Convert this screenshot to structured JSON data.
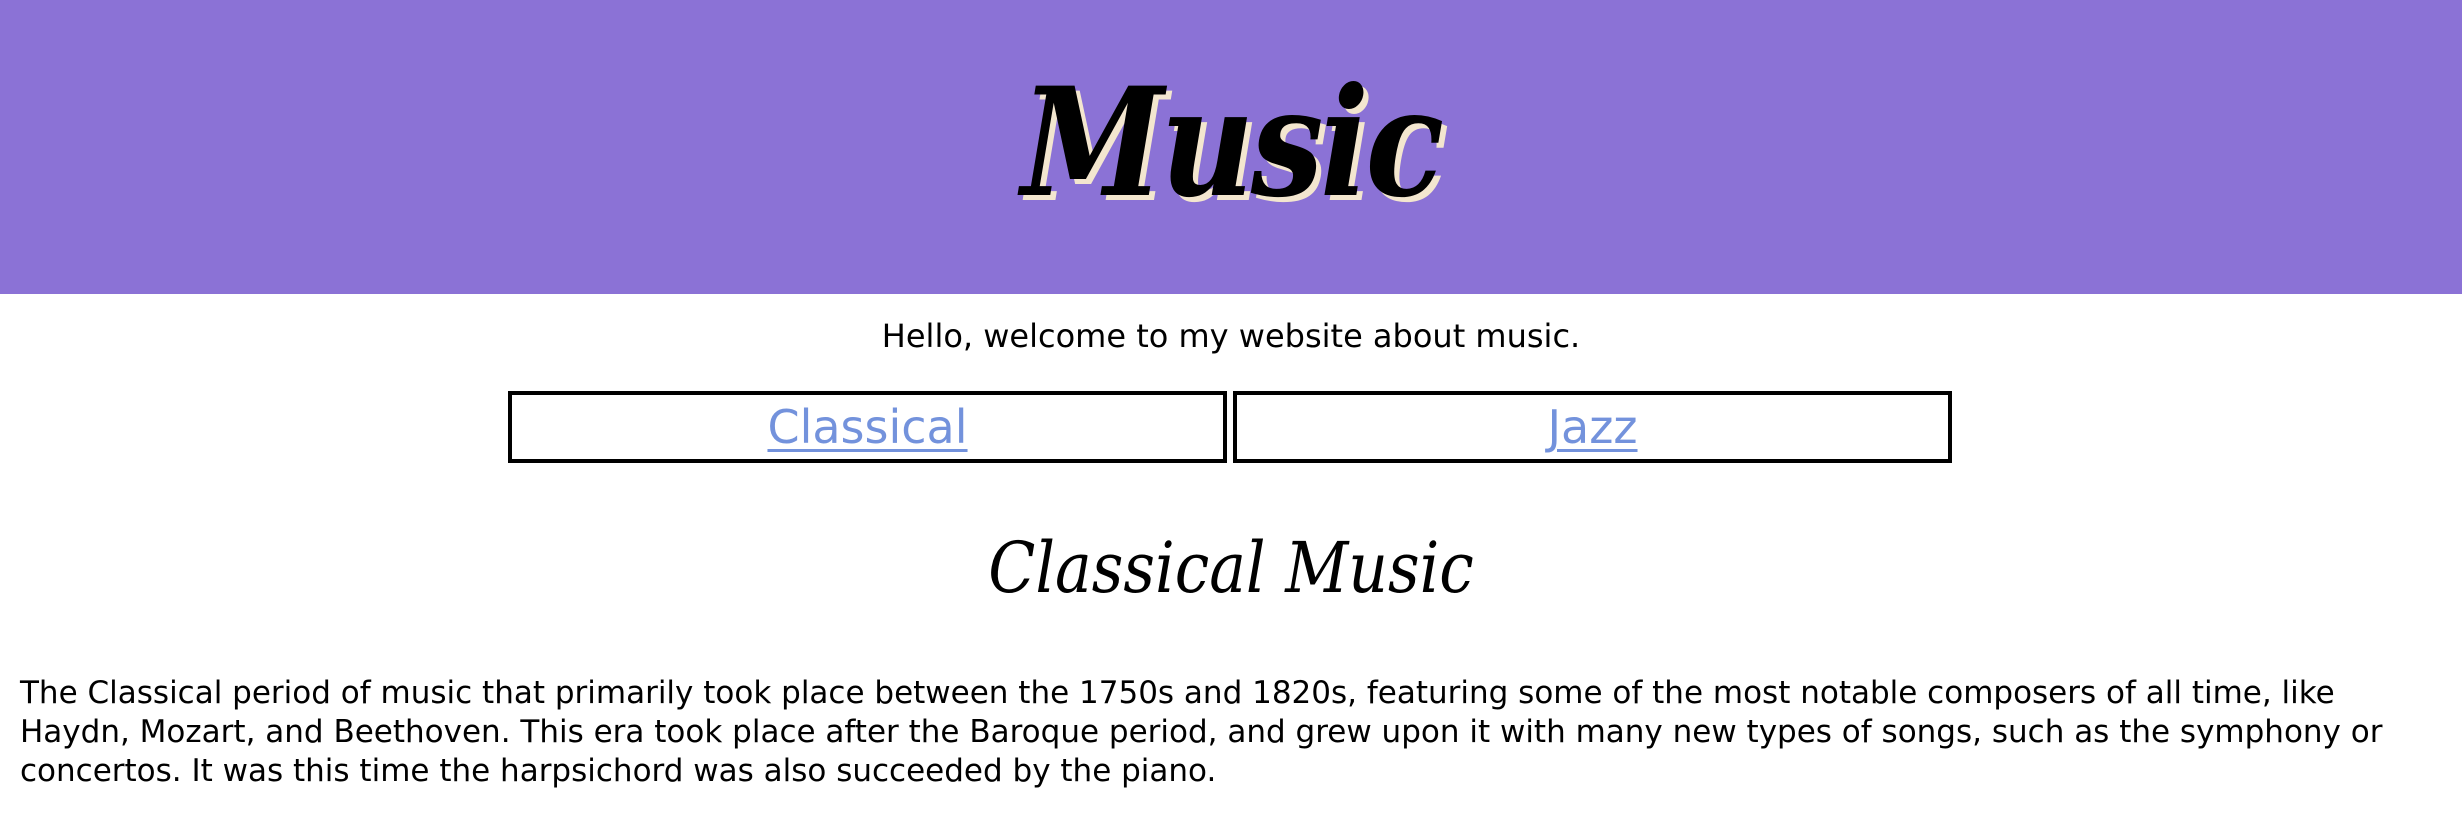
{
  "header": {
    "title": "Music"
  },
  "welcome": "Hello, welcome to my website about music.",
  "nav": {
    "items": [
      {
        "label": "Classical"
      },
      {
        "label": "Jazz"
      }
    ]
  },
  "section": {
    "title": "Classical Music",
    "body": "The Classical period of music that primarily took place between the 1750s and 1820s, featuring some of the most notable composers of all time, like Haydn, Mozart, and Beethoven. This era took place after the Baroque period, and grew upon it with many new types of songs, such as the symphony or concertos. It was this time the harpsichord was also succeeded by the piano."
  },
  "colors": {
    "banner_background": "#8b72d6",
    "title_shadow": "#f3e6cf",
    "link": "#7392dc"
  }
}
